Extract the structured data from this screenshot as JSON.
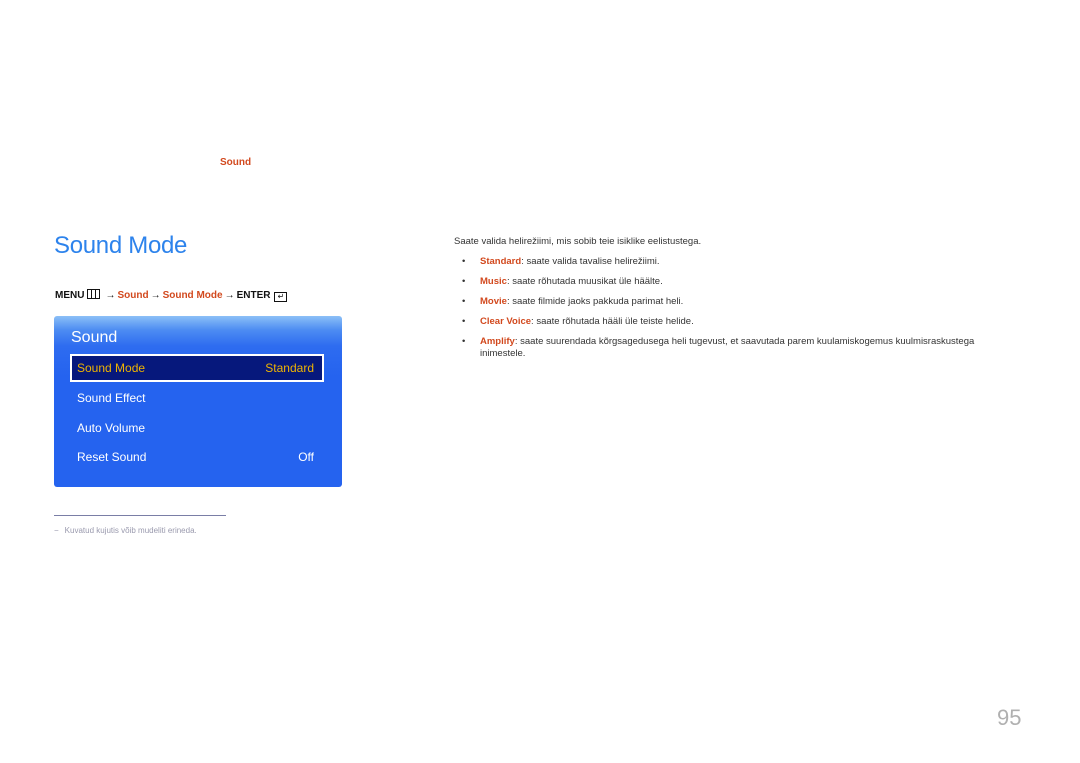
{
  "chapter_label": "Sound",
  "section": {
    "title": "Sound Mode",
    "nav_path": {
      "menu": "MENU",
      "menu_icon": "menu-grid-icon",
      "arrow": "→",
      "step1": "Sound",
      "step2": "Sound Mode",
      "enter": "ENTER",
      "enter_icon": "enter-icon"
    }
  },
  "osd": {
    "title": "Sound",
    "items": [
      {
        "label": "Sound Mode",
        "value": "Standard",
        "selected": true
      },
      {
        "label": "Sound Effect",
        "value": ""
      },
      {
        "label": "Auto Volume",
        "value": ""
      },
      {
        "label": "Reset Sound",
        "value": "Off"
      }
    ]
  },
  "footnote": {
    "dash": "−",
    "text": "Kuvatud kujutis võib mudeliti erineda."
  },
  "description": "Saate valida helirežiimi, mis sobib teie isiklike eelistustega.",
  "options": [
    {
      "term": "Standard",
      "text": ": saate valida tavalise helirežiimi."
    },
    {
      "term": "Music",
      "text": ": saate rõhutada muusikat üle häälte."
    },
    {
      "term": "Movie",
      "text": ": saate filmide jaoks pakkuda parimat heli."
    },
    {
      "term": "Clear Voice",
      "text": ": saate rõhutada hääli üle teiste helide."
    },
    {
      "term": "Amplify",
      "text": ": saate suurendada kõrgsagedusega heli tugevust, et saavutada parem kuulamiskogemus kuulmisraskustega inimestele."
    }
  ],
  "bullet_char": "•",
  "page_number": "95",
  "colors": {
    "accent_red": "#d2491e",
    "title_blue": "#2d83ec",
    "osd_blue": "#2563ef",
    "osd_selected": "#06187c",
    "osd_selected_text": "#f0b400"
  }
}
